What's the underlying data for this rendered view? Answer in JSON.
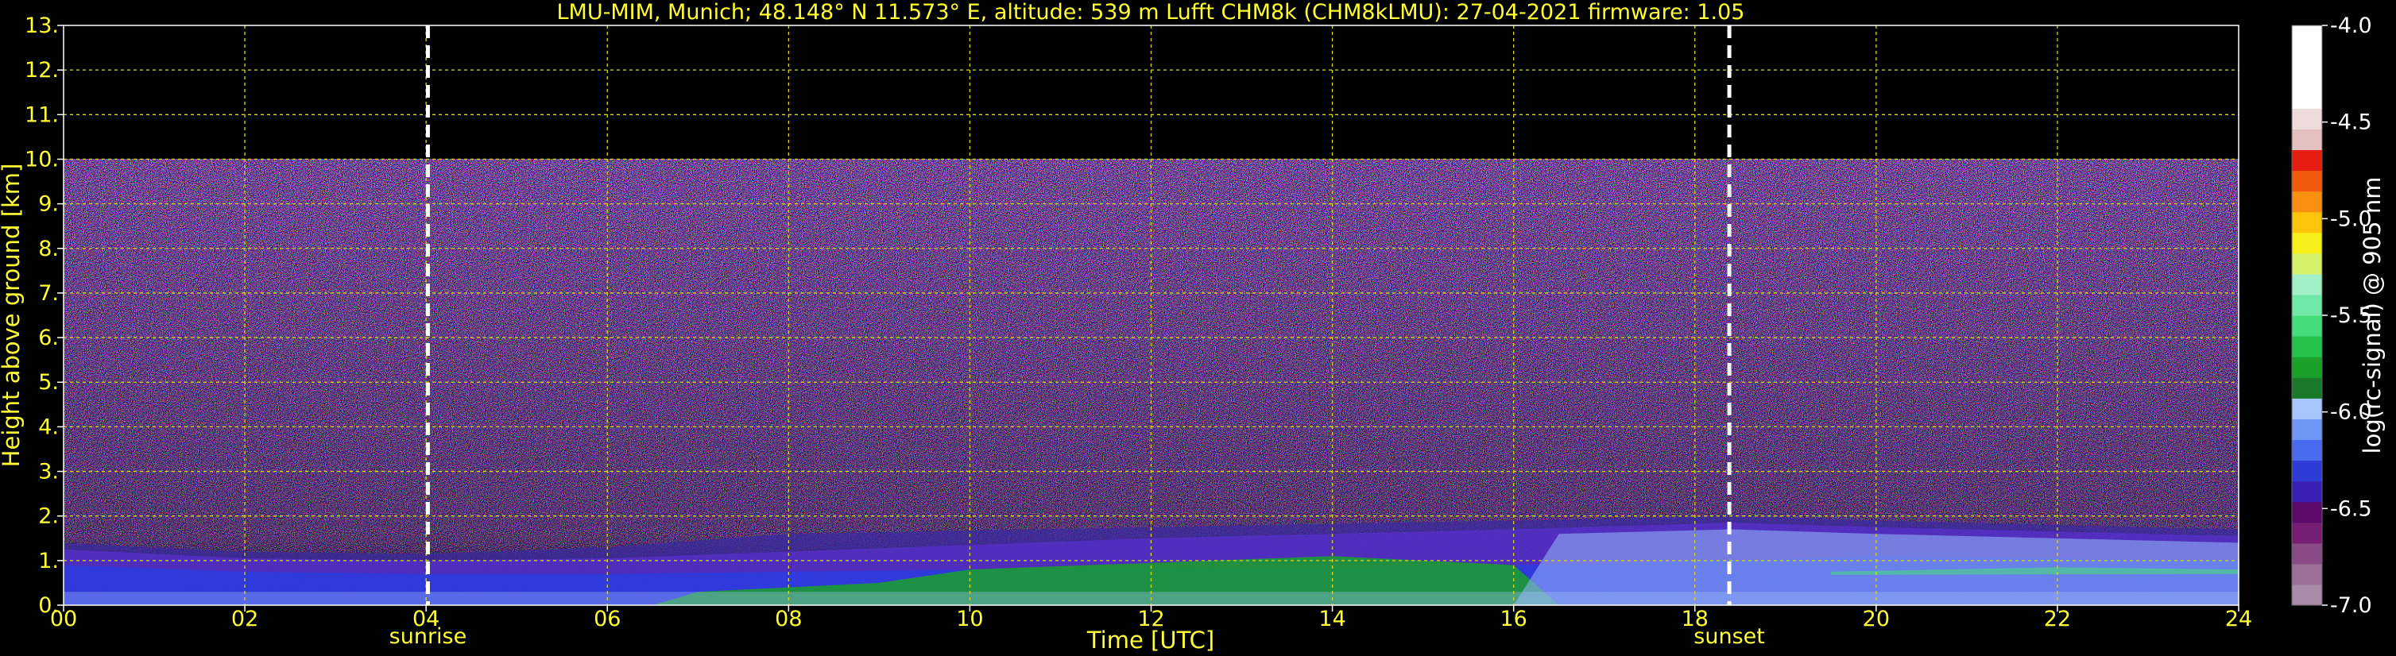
{
  "chart_data": {
    "type": "heatmap",
    "title": "LMU-MIM, Munich; 48.148° N 11.573° E, altitude: 539 m    Lufft CHM8k (CHM8kLMU): 27-04-2021    firmware: 1.05",
    "xlabel": "Time [UTC]",
    "ylabel": "Height above ground [km]",
    "xlim": [
      0,
      24
    ],
    "ylim": [
      0,
      13
    ],
    "x_ticks": [
      "00",
      "02",
      "04",
      "06",
      "08",
      "10",
      "12",
      "14",
      "16",
      "18",
      "20",
      "22",
      "24"
    ],
    "y_ticks": [
      "0.",
      "1.",
      "2.",
      "3.",
      "4.",
      "5.",
      "6.",
      "7.",
      "8.",
      "9.",
      "10.",
      "11.",
      "12.",
      "13."
    ],
    "grid": true,
    "data_top_km": 10,
    "events": [
      {
        "label": "sunrise",
        "time": 4.02
      },
      {
        "label": "sunset",
        "time": 18.38
      }
    ],
    "colorbar": {
      "label": "log(rc-signal) @ 905 nm",
      "ticks": [
        "-4.0",
        "-4.5",
        "-5.0",
        "-5.5",
        "-6.0",
        "-6.5",
        "-7.0"
      ],
      "range": [
        -7.0,
        -4.0
      ],
      "colors": [
        "#a98aa6",
        "#9c6f98",
        "#8a4a86",
        "#751e73",
        "#5c0a6a",
        "#3a1fb5",
        "#2e3cd6",
        "#4a6af0",
        "#6d96f5",
        "#a7c7fb",
        "#1a7a2a",
        "#1aa12a",
        "#25c34a",
        "#45dd7a",
        "#6fe8a8",
        "#a2f0c8",
        "#d6f26a",
        "#f7ef19",
        "#fcc40a",
        "#f99012",
        "#f25a10",
        "#e51c10",
        "#e4c0c0",
        "#eedcdc",
        "#ffffff",
        "#ffffff",
        "#ffffff",
        "#ffffff"
      ]
    }
  }
}
